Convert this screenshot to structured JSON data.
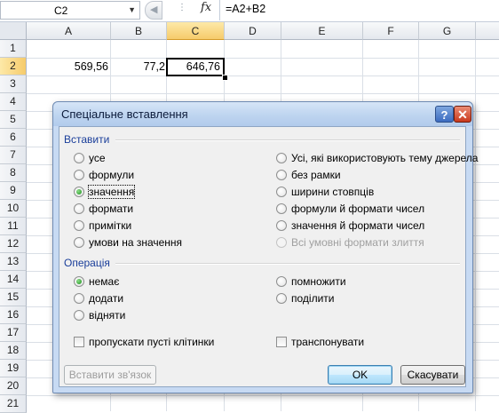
{
  "formula_bar": {
    "name_box": "C2",
    "fx_label": "fx",
    "formula": "=A2+B2"
  },
  "grid": {
    "columns": [
      "A",
      "B",
      "C",
      "D",
      "E",
      "F",
      "G"
    ],
    "selected_column": "C",
    "rows": [
      "1",
      "2",
      "3",
      "4",
      "5",
      "6",
      "7",
      "8",
      "9",
      "10",
      "11",
      "12",
      "13",
      "14",
      "15",
      "16",
      "17",
      "18",
      "19",
      "20",
      "21"
    ],
    "selected_row": "2",
    "cells": {
      "A2": "569,56",
      "B2": "77,2",
      "C2": "646,76"
    }
  },
  "dialog": {
    "title": "Спеціальне вставлення",
    "help_label": "?",
    "close_label": "✕",
    "paste_group": {
      "label": "Вставити",
      "left_options": [
        "усе",
        "формули",
        "значення",
        "формати",
        "примітки",
        "умови на значення"
      ],
      "right_options": [
        "Усі, які використовують тему джерела",
        "без рамки",
        "ширини стовпців",
        "формули й формати чисел",
        "значення й формати чисел",
        "Всі умовні формати злиття"
      ],
      "selected": "значення"
    },
    "operation_group": {
      "label": "Операція",
      "left_options": [
        "немає",
        "додати",
        "відняти"
      ],
      "right_options": [
        "помножити",
        "поділити"
      ],
      "selected": "немає"
    },
    "skip_blanks_label": "пропускати пусті клітинки",
    "skip_blanks_checked": false,
    "transpose_label": "транспонувати",
    "transpose_checked": false,
    "paste_link_label": "Вставити зв'язок",
    "ok_label": "OK",
    "cancel_label": "Скасувати"
  },
  "colors": {
    "selection_highlight": "#f6cb6b",
    "dialog_frame": "#c7daf3",
    "group_label": "#1a3e9a",
    "radio_checked": "#1a8c1a"
  }
}
